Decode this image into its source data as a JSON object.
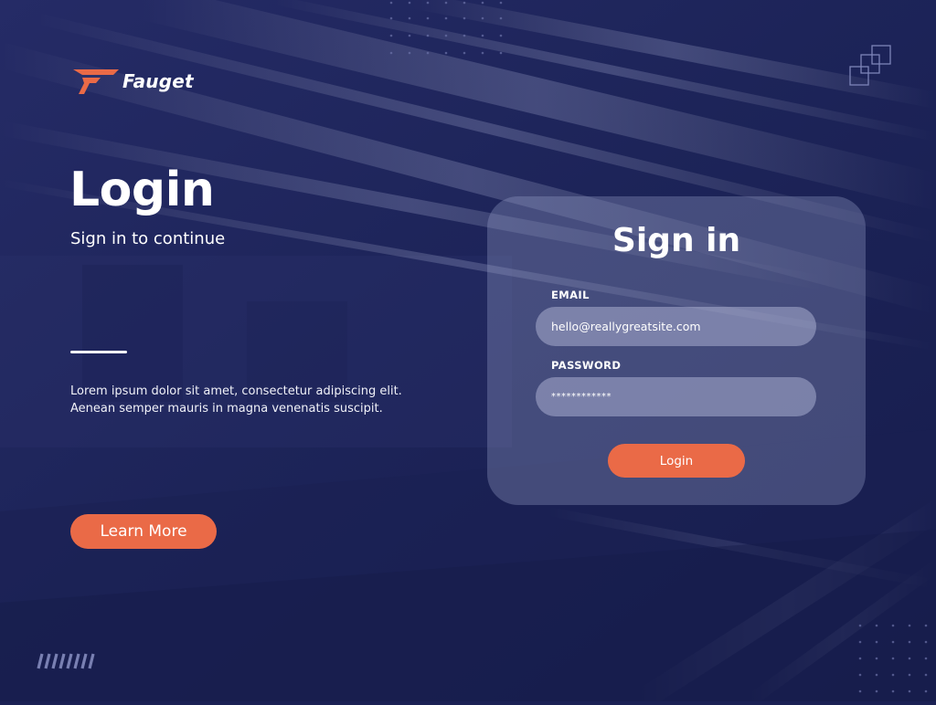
{
  "brand": {
    "name": "Fauget",
    "accent_color": "#ea6a47",
    "background_color": "#1b2154"
  },
  "hero": {
    "title": "Login",
    "subtitle": "Sign in to continue",
    "body_line1": "Lorem ipsum dolor sit amet, consectetur adipiscing elit.",
    "body_line2": "Aenean semper mauris in magna venenatis suscipit.",
    "cta_label": "Learn More"
  },
  "signin": {
    "title": "Sign in",
    "email_label": "EMAIL",
    "email_value": "hello@reallygreatsite.com",
    "password_label": "PASSWORD",
    "password_value": "************",
    "submit_label": "Login"
  },
  "decorations": {
    "top_right_icon": "stacked-squares-icon",
    "bottom_left_icon": "slash-pattern-icon",
    "dot_grid_icon": "dot-grid-icon"
  }
}
